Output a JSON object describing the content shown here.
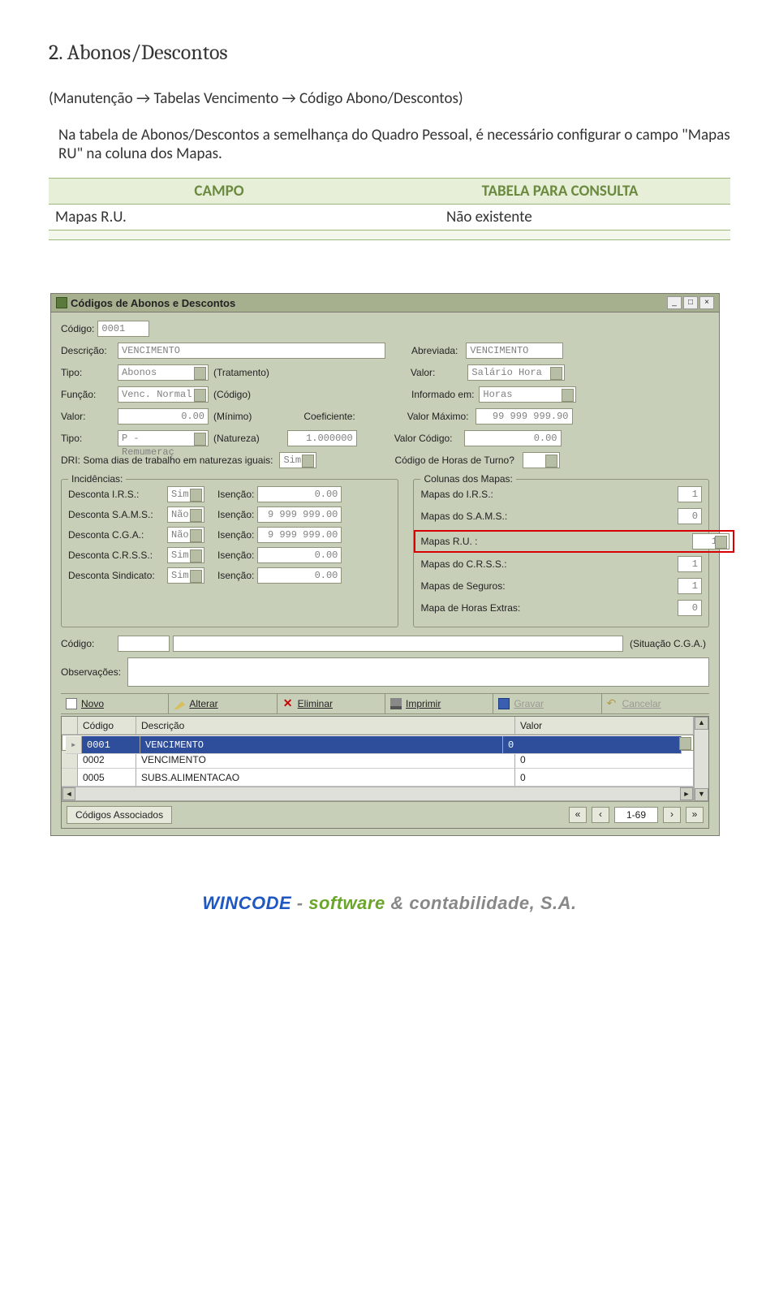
{
  "doc": {
    "heading": "2. Abonos/Descontos",
    "breadcrumb": "(Manutenção → Tabelas Vencimento → Código Abono/Descontos)",
    "intro": "Na tabela de Abonos/Descontos a semelhança do Quadro Pessoal, é necessário configurar o campo \"Mapas RU\" na coluna dos Mapas.",
    "table": {
      "col1_header": "CAMPO",
      "col2_header": "TABELA PARA CONSULTA",
      "row1_campo": "Mapas R.U.",
      "row1_valor": "Não existente"
    }
  },
  "app": {
    "title": "Códigos de Abonos e Descontos",
    "labels": {
      "codigo": "Código:",
      "descricao": "Descrição:",
      "abreviada": "Abreviada:",
      "tipo": "Tipo:",
      "tratamento": "(Tratamento)",
      "valor": "Valor:",
      "funcao": "Função:",
      "codigo_paren": "(Código)",
      "informado_em": "Informado em:",
      "minimo": "(Mínimo)",
      "valor_maximo": "Valor Máximo:",
      "natureza": "(Natureza)",
      "coeficiente": "Coeficiente:",
      "valor_codigo": "Valor Código:",
      "dri": "DRI: Soma dias de trabalho em naturezas iguais:",
      "codigo_horas_turno": "Código de Horas de Turno?",
      "incidencias": "Incidências:",
      "colunas_mapas": "Colunas dos Mapas:",
      "desc_irs": "Desconta I.R.S.:",
      "desc_sams": "Desconta S.A.M.S.:",
      "desc_cga": "Desconta C.G.A.:",
      "desc_crss": "Desconta C.R.S.S.:",
      "desc_sind": "Desconta Sindicato:",
      "isencao": "Isenção:",
      "mapas_irs": "Mapas do I.R.S.:",
      "mapas_sams": "Mapas do S.A.M.S.:",
      "mapas_ru": "Mapas R.U. :",
      "mapas_crss": "Mapas do C.R.S.S.:",
      "mapas_seguros": "Mapas de Seguros:",
      "mapa_horas_extras": "Mapa de Horas Extras:",
      "situacao_cga": "(Situação C.G.A.)",
      "observacoes": "Observações:",
      "codigos_assoc": "Códigos Associados"
    },
    "values": {
      "codigo": "0001",
      "descricao": "VENCIMENTO",
      "abreviada": "VENCIMENTO",
      "tipo": "Abonos",
      "valor": "Salário Hora",
      "funcao": "Venc. Normal",
      "informado_em": "Horas",
      "valor_min": "0.00",
      "valor_maximo": "99 999 999.90",
      "tipo2": "P - Remumeraç",
      "coeficiente": "1.000000",
      "valor_codigo": "0.00",
      "dri": "Sim",
      "isen_irs": "0.00",
      "isen_sams": "9 999 999.00",
      "isen_cga": "9 999 999.00",
      "isen_crss": "0.00",
      "isen_sind": "0.00",
      "sel_irs": "Sim",
      "sel_sams": "Não",
      "sel_cga": "Não",
      "sel_crss": "Sim",
      "sel_sind": "Sim",
      "col_irs": "1",
      "col_sams": "0",
      "col_ru": "1",
      "col_crss": "1",
      "col_seguros": "1",
      "col_he": "0",
      "sit_cga_code": "",
      "sit_cga_desc": "",
      "observacoes": ""
    },
    "toolbar": {
      "novo": "Novo",
      "alterar": "Alterar",
      "eliminar": "Eliminar",
      "imprimir": "Imprimir",
      "gravar": "Gravar",
      "cancelar": "Cancelar"
    },
    "grid": {
      "h_codigo": "Código",
      "h_descricao": "Descrição",
      "h_valor": "Valor",
      "rows": [
        {
          "codigo": "0001",
          "desc": "VENCIMENTO",
          "valor": "0",
          "sel": true
        },
        {
          "codigo": "0002",
          "desc": "VENCIMENTO",
          "valor": "0",
          "sel": false
        },
        {
          "codigo": "0005",
          "desc": "SUBS.ALIMENTACAO",
          "valor": "0",
          "sel": false
        }
      ],
      "page_ind": "1-69"
    }
  },
  "footer": {
    "brand": "WINCODE",
    "sep": " - ",
    "t1": "software",
    "amp": " & ",
    "t2": "contabilidade, S.A."
  }
}
